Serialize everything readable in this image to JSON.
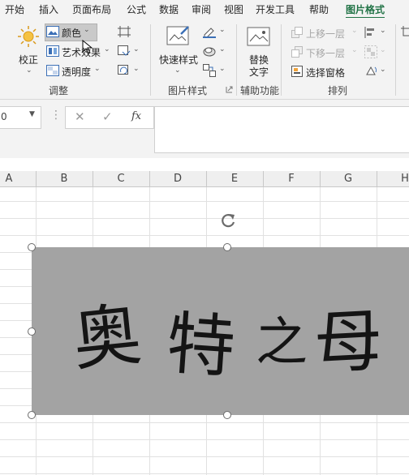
{
  "ribbon_tabs": [
    "开始",
    "插入",
    "页面布局",
    "公式",
    "数据",
    "审阅",
    "视图",
    "开发工具",
    "帮助",
    "图片格式"
  ],
  "active_tab": "图片格式",
  "adjust": {
    "correct_label": "校正",
    "color_label": "颜色",
    "artistic_label": "艺术效果",
    "transparency_label": "透明度",
    "group_label": "调整"
  },
  "picture_styles": {
    "quick_styles_label": "快速样式",
    "group_label": "图片样式"
  },
  "accessibility": {
    "alt_text_label_line1": "替换",
    "alt_text_label_line2": "文字",
    "group_label": "辅助功能"
  },
  "arrange": {
    "bring_forward_label": "上移一层",
    "send_backward_label": "下移一层",
    "selection_pane_label": "选择窗格",
    "group_label": "排列"
  },
  "formula_bar": {
    "name_box_value": "0",
    "cancel_symbol": "✕",
    "enter_symbol": "✓",
    "fx_label": "fx",
    "formula_value": ""
  },
  "columns": [
    "A",
    "B",
    "C",
    "D",
    "E",
    "F",
    "G",
    "H"
  ],
  "picture": {
    "characters": [
      "奥",
      "特",
      "之",
      "母"
    ]
  },
  "colors": {
    "accent": "#217346",
    "picture_bg": "#a3a3a3",
    "ribbon_bg": "#f3f3f3"
  }
}
